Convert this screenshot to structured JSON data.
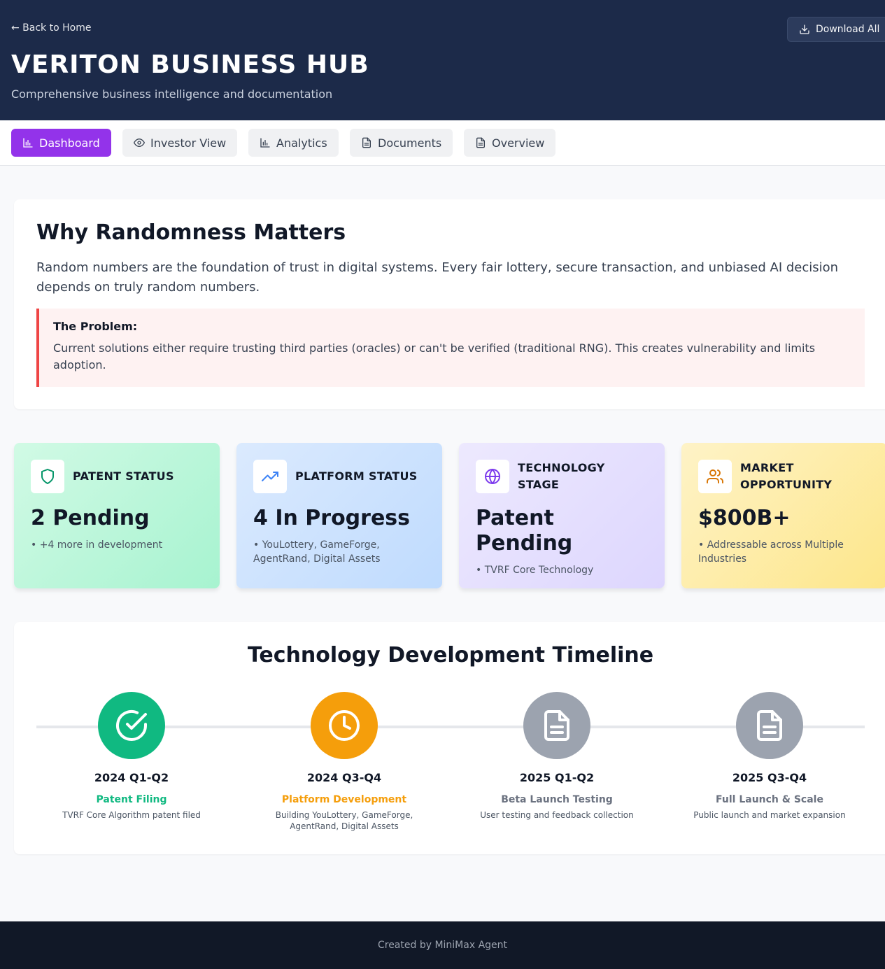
{
  "header": {
    "back_label": "← Back to Home",
    "download_label": "Download All",
    "title": "VERITON BUSINESS HUB",
    "subtitle": "Comprehensive business intelligence and documentation"
  },
  "nav": {
    "tabs": [
      {
        "label": "Dashboard",
        "icon": "bar-chart-icon",
        "active": true
      },
      {
        "label": "Investor View",
        "icon": "eye-icon",
        "active": false
      },
      {
        "label": "Analytics",
        "icon": "bar-chart-icon",
        "active": false
      },
      {
        "label": "Documents",
        "icon": "document-icon",
        "active": false
      },
      {
        "label": "Overview",
        "icon": "document-icon",
        "active": false
      }
    ]
  },
  "why": {
    "title": "Why Randomness Matters",
    "text": "Random numbers are the foundation of trust in digital systems. Every fair lottery, secure transaction, and unbiased AI decision depends on truly random numbers.",
    "problem_title": "The Problem:",
    "problem_text": "Current solutions either require trusting third parties (oracles) or can't be verified (traditional RNG). This creates vulnerability and limits adoption."
  },
  "stats": [
    {
      "label": "PATENT STATUS",
      "value": "2 Pending",
      "note": "• +4 more in development",
      "icon": "shield-icon",
      "accent": "#059669"
    },
    {
      "label": "PLATFORM STATUS",
      "value": "4 In Progress",
      "note": "• YouLottery, GameForge, AgentRand, Digital Assets",
      "icon": "trending-up-icon",
      "accent": "#3b82f6"
    },
    {
      "label": "TECHNOLOGY STAGE",
      "value": "Patent Pending",
      "note": "• TVRF Core Technology",
      "icon": "globe-icon",
      "accent": "#7c3aed"
    },
    {
      "label": "MARKET OPPORTUNITY",
      "value": "$800B+",
      "note": "• Addressable across Multiple Industries",
      "icon": "users-icon",
      "accent": "#d97706"
    }
  ],
  "timeline": {
    "title": "Technology Development Timeline",
    "milestones": [
      {
        "period": "2024 Q1-Q2",
        "name": "Patent Filing",
        "desc": "TVRF Core Algorithm patent filed",
        "icon": "check-circle-icon",
        "color": "#10b981"
      },
      {
        "period": "2024 Q3-Q4",
        "name": "Platform Development",
        "desc": "Building YouLottery, GameForge, AgentRand, Digital Assets",
        "icon": "clock-icon",
        "color": "#f59e0b"
      },
      {
        "period": "2025 Q1-Q2",
        "name": "Beta Launch Testing",
        "desc": "User testing and feedback collection",
        "icon": "document-icon",
        "color": "#9ca3af"
      },
      {
        "period": "2025 Q3-Q4",
        "name": "Full Launch & Scale",
        "desc": "Public launch and market expansion",
        "icon": "document-icon",
        "color": "#9ca3af"
      }
    ]
  },
  "footer": {
    "text": "Created by MiniMax Agent"
  }
}
